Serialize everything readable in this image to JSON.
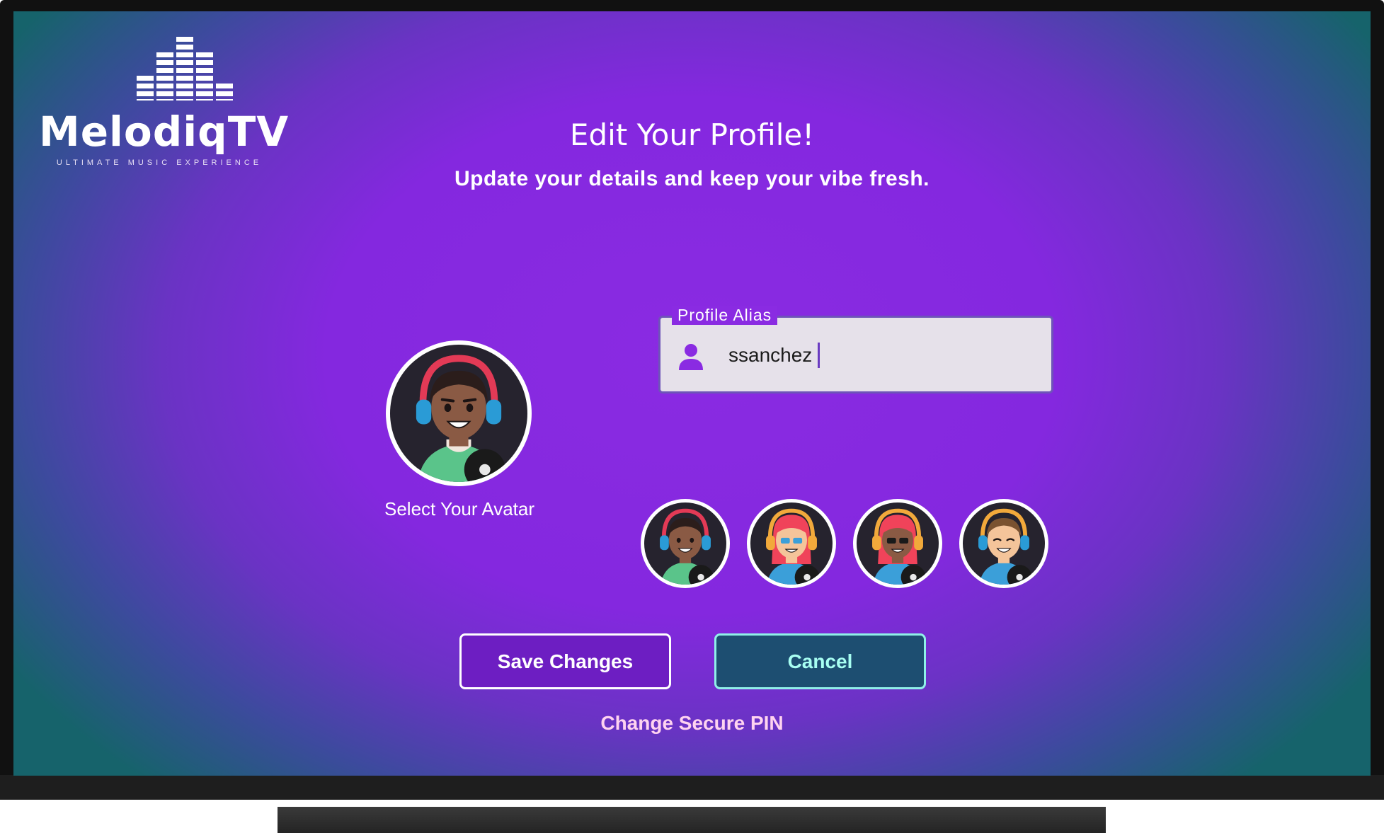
{
  "brand": {
    "name": "MelodiqTV",
    "tagline": "ULTIMATE MUSIC EXPERIENCE"
  },
  "header": {
    "title": "Edit Your Profile!",
    "subtitle": "Update your details and keep your vibe fresh."
  },
  "avatar": {
    "label": "Select Your Avatar",
    "selected": "avatar-1",
    "options": [
      {
        "id": "avatar-1",
        "hair": "#2b1d1b",
        "skin": "#8a5a44",
        "headphone": "#e33a56",
        "cup": "#2a9bd6",
        "shirt": "#5ac48a"
      },
      {
        "id": "avatar-2",
        "hair": "#f0435a",
        "skin": "#f4c49a",
        "headphone": "#f2a93b",
        "cup": "#f2a93b",
        "shirt": "#3b9fd9"
      },
      {
        "id": "avatar-3",
        "hair": "#f0435a",
        "skin": "#8a5a44",
        "headphone": "#f2a93b",
        "cup": "#f2a93b",
        "shirt": "#3b9fd9"
      },
      {
        "id": "avatar-4",
        "hair": "#7a5230",
        "skin": "#f4c49a",
        "headphone": "#f2a93b",
        "cup": "#2a9bd6",
        "shirt": "#3b9fd9"
      }
    ]
  },
  "alias": {
    "label": "Profile Alias",
    "value": "ssanchez",
    "icon": "person-icon"
  },
  "actions": {
    "save_label": "Save Changes",
    "cancel_label": "Cancel",
    "pin_label": "Change Secure PIN"
  },
  "colors": {
    "accent": "#8a2be2",
    "save_bg": "#6d1ec2",
    "cancel_bg": "#1d4e71",
    "cancel_border": "#8ff0e8",
    "link": "#ffd3f0"
  }
}
